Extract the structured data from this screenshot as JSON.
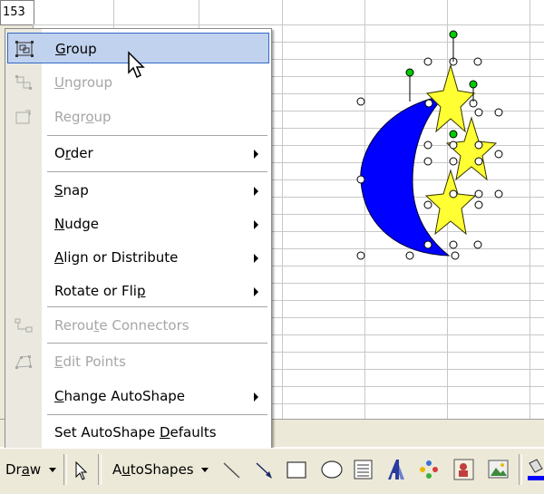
{
  "spreadsheet": {
    "cell_reference": "153"
  },
  "menu": {
    "items": [
      {
        "id": "group",
        "label_pre": "",
        "label_key": "G",
        "label_post": "roup",
        "enabled": true,
        "highlighted": true,
        "submenu": false,
        "icon": "group-icon"
      },
      {
        "id": "ungroup",
        "label_pre": "",
        "label_key": "U",
        "label_post": "ngroup",
        "enabled": false,
        "submenu": false,
        "icon": "ungroup-icon"
      },
      {
        "id": "regroup",
        "label_pre": "Regr",
        "label_key": "o",
        "label_post": "up",
        "enabled": false,
        "submenu": false,
        "icon": "regroup-icon"
      },
      {
        "id": "order",
        "label_pre": "O",
        "label_key": "r",
        "label_post": "der",
        "enabled": true,
        "submenu": true
      },
      {
        "id": "snap",
        "label_pre": "",
        "label_key": "S",
        "label_post": "nap",
        "enabled": true,
        "submenu": true
      },
      {
        "id": "nudge",
        "label_pre": "",
        "label_key": "N",
        "label_post": "udge",
        "enabled": true,
        "submenu": true
      },
      {
        "id": "align",
        "label_pre": "",
        "label_key": "A",
        "label_post": "lign or Distribute",
        "enabled": true,
        "submenu": true
      },
      {
        "id": "rotate",
        "label_pre": "Rotate or Fli",
        "label_key": "p",
        "label_post": "",
        "enabled": true,
        "submenu": true
      },
      {
        "id": "reroute",
        "label_pre": "Rerou",
        "label_key": "t",
        "label_post": "e Connectors",
        "enabled": false,
        "submenu": false,
        "icon": "reroute-connectors-icon"
      },
      {
        "id": "editpoints",
        "label_pre": "",
        "label_key": "E",
        "label_post": "dit Points",
        "enabled": false,
        "submenu": false,
        "icon": "edit-points-icon"
      },
      {
        "id": "change",
        "label_pre": "",
        "label_key": "C",
        "label_post": "hange AutoShape",
        "enabled": true,
        "submenu": true
      },
      {
        "id": "defaults",
        "label_pre": "Set AutoShape ",
        "label_key": "D",
        "label_post": "efaults",
        "enabled": true,
        "submenu": false
      }
    ]
  },
  "toolbar": {
    "draw_pre": "Dr",
    "draw_key": "a",
    "draw_post": "w",
    "autoshapes_pre": "A",
    "autoshapes_key": "u",
    "autoshapes_post": "toShapes"
  },
  "colors": {
    "moon": "#0000ff",
    "star": "#ffff33",
    "highlight": "#c1d2ee",
    "handle_green": "#00cc00"
  }
}
